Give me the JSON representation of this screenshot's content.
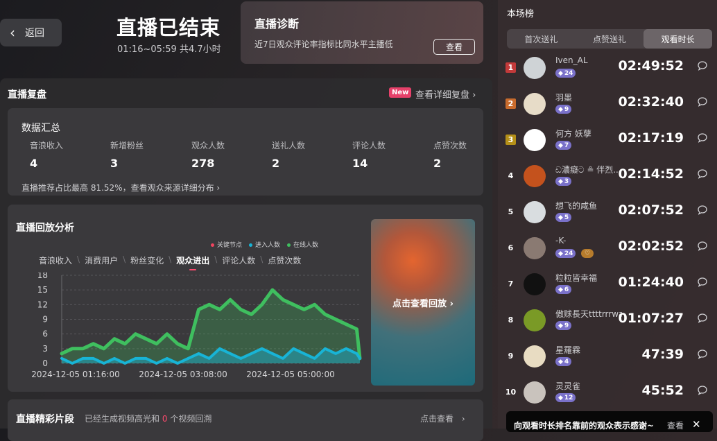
{
  "header": {
    "back_label": "返回",
    "title": "直播已结束",
    "time_range": "01:16~05:59 共4.7小时"
  },
  "diagnosis": {
    "title": "直播诊断",
    "desc": "近7日观众评论率指标比同水平主播低",
    "button": "查看"
  },
  "review": {
    "title": "直播复盘",
    "new_badge": "New",
    "detail_link": "查看详细复盘 ›",
    "summary": {
      "title": "数据汇总",
      "metrics": [
        {
          "label": "音浪收入",
          "value": "4"
        },
        {
          "label": "新增粉丝",
          "value": "3"
        },
        {
          "label": "观众人数",
          "value": "278"
        },
        {
          "label": "送礼人数",
          "value": "2"
        },
        {
          "label": "评论人数",
          "value": "14"
        },
        {
          "label": "点赞次数",
          "value": "2"
        }
      ],
      "note": "直播推荐占比最高 81.52%，查看观众来源详细分布 ›"
    },
    "playback": {
      "title": "直播回放分析",
      "legend": [
        {
          "label": "关键节点",
          "color": "#f0445f"
        },
        {
          "label": "进入人数",
          "color": "#18b4d6"
        },
        {
          "label": "在线人数",
          "color": "#3fbf5f"
        }
      ],
      "tabs": [
        "音浪收入",
        "消费用户",
        "粉丝变化",
        "观众进出",
        "评论人数",
        "点赞次数"
      ],
      "active_tab": "观众进出",
      "video_label": "点击查看回放 ›"
    },
    "highlights": {
      "title": "直播精彩片段",
      "desc_prefix": "已经生成视频高光和",
      "count": "0",
      "desc_suffix": "个视频回溯",
      "link": "点击查看"
    }
  },
  "chart_data": {
    "type": "area",
    "title": "",
    "xlabel": "",
    "ylabel": "",
    "ylim": [
      0,
      18
    ],
    "y_ticks": [
      "18",
      "15",
      "12",
      "9",
      "6",
      "3",
      "0"
    ],
    "x_ticks": [
      "2024-12-05 01:16:00",
      "2024-12-05 03:08:00",
      "2024-12-05 05:00:00"
    ],
    "x_range_minutes": [
      0,
      283
    ],
    "grid": true,
    "series": [
      {
        "name": "在线人数",
        "color": "#3fbf5f",
        "x": [
          0,
          10,
          20,
          30,
          40,
          50,
          60,
          70,
          80,
          90,
          100,
          110,
          120,
          130,
          140,
          150,
          160,
          170,
          180,
          190,
          200,
          210,
          220,
          230,
          240,
          250,
          260,
          270,
          280,
          283
        ],
        "values": [
          2,
          3,
          3,
          4,
          3,
          5,
          4,
          6,
          5,
          4,
          6,
          4,
          3,
          11,
          12,
          11,
          13,
          11,
          10,
          12,
          15,
          13,
          12,
          11,
          12,
          10,
          9,
          8,
          7,
          1
        ]
      },
      {
        "name": "进入人数",
        "color": "#18b4d6",
        "x": [
          0,
          10,
          20,
          30,
          40,
          50,
          60,
          70,
          80,
          90,
          100,
          110,
          120,
          130,
          140,
          150,
          160,
          170,
          180,
          190,
          200,
          210,
          220,
          230,
          240,
          250,
          260,
          270,
          280,
          283
        ],
        "values": [
          1,
          0,
          1,
          1,
          0,
          1,
          0,
          1,
          1,
          0,
          1,
          0,
          1,
          2,
          1,
          3,
          2,
          1,
          2,
          3,
          2,
          1,
          3,
          2,
          1,
          3,
          2,
          3,
          2,
          1
        ]
      }
    ]
  },
  "ranking": {
    "title": "本场榜",
    "tabs": [
      "首次送礼",
      "点赞送礼",
      "观看时长"
    ],
    "active_tab": "观看时长",
    "rows": [
      {
        "rank": "1",
        "name": "Iven_AL",
        "level": "24",
        "duration": "02:49:52",
        "rank_color": "#c33a3a",
        "avatar": "#cfd3d6"
      },
      {
        "rank": "2",
        "name": "羽墨",
        "level": "9",
        "duration": "02:32:40",
        "rank_color": "#c86b2d",
        "avatar": "#e7dcc8"
      },
      {
        "rank": "3",
        "name": "何方 妖孽",
        "level": "7",
        "duration": "02:17:19",
        "rank_color": "#b59018",
        "avatar": "#ffffff"
      },
      {
        "rank": "4",
        "name": "ඩ濃癡ට ≗ 伴烈...",
        "level": "3",
        "duration": "02:14:52",
        "rank_color": "",
        "avatar": "#c4521d"
      },
      {
        "rank": "5",
        "name": "想飞的咸鱼",
        "level": "5",
        "duration": "02:07:52",
        "rank_color": "",
        "avatar": "#d9dde0"
      },
      {
        "rank": "6",
        "name": "-K-",
        "level": "24",
        "duration": "02:02:52",
        "rank_color": "",
        "avatar": "#8a7a72",
        "badge2": "♡"
      },
      {
        "rank": "7",
        "name": "粒粒皆幸福",
        "level": "6",
        "duration": "01:24:40",
        "rank_color": "",
        "avatar": "#111111"
      },
      {
        "rank": "8",
        "name": "傲赇長天ttttrrrwa",
        "level": "9",
        "duration": "01:07:27",
        "rank_color": "",
        "avatar": "#7a9a26"
      },
      {
        "rank": "9",
        "name": "星羅霖",
        "level": "4",
        "duration": "47:39",
        "rank_color": "",
        "avatar": "#e8dcc2"
      },
      {
        "rank": "10",
        "name": "灵灵雀",
        "level": "12",
        "duration": "45:52",
        "rank_color": "",
        "avatar": "#c9c3bd"
      }
    ]
  },
  "toast": {
    "text": "向观看时长排名靠前的观众表示感谢~",
    "view": "查看",
    "close": "✕"
  }
}
